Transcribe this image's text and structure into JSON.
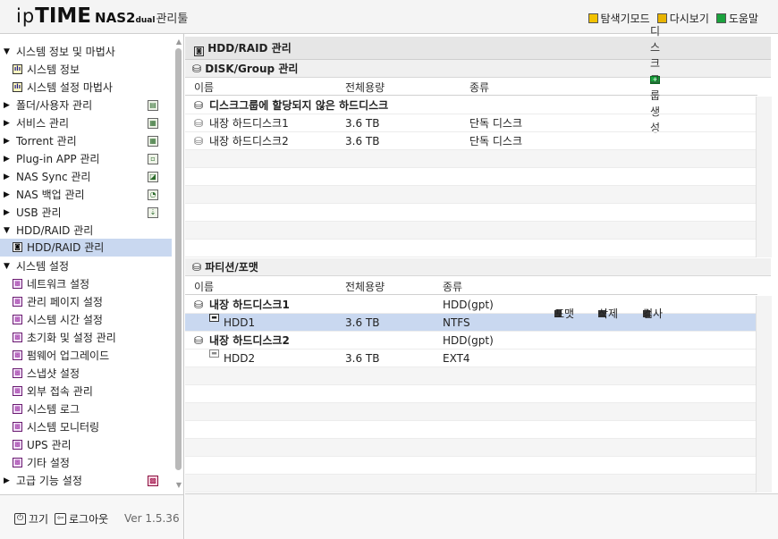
{
  "header": {
    "logo_ip": "ip",
    "logo_time": "TIME",
    "logo_model": "NAS2",
    "logo_sub": "dual",
    "logo_tool": "관리툴",
    "links": [
      {
        "label": "탐색기모드",
        "icon": "explorer-icon"
      },
      {
        "label": "다시보기",
        "icon": "refresh-icon"
      },
      {
        "label": "도움말",
        "icon": "help-icon"
      }
    ]
  },
  "sidebar": {
    "items": [
      {
        "label": "시스템 정보 및 마법사",
        "level": 0,
        "expanded": true
      },
      {
        "label": "시스템 정보",
        "level": 1
      },
      {
        "label": "시스템 설정 마법사",
        "level": 1
      },
      {
        "label": "폴더/사용자 관리",
        "level": 0,
        "expanded": false
      },
      {
        "label": "서비스 관리",
        "level": 0,
        "expanded": false
      },
      {
        "label": "Torrent 관리",
        "level": 0,
        "expanded": false
      },
      {
        "label": "Plug-in APP 관리",
        "level": 0,
        "expanded": false
      },
      {
        "label": "NAS Sync 관리",
        "level": 0,
        "expanded": false
      },
      {
        "label": "NAS 백업 관리",
        "level": 0,
        "expanded": false
      },
      {
        "label": "USB 관리",
        "level": 0,
        "expanded": false
      },
      {
        "label": "HDD/RAID 관리",
        "level": 0,
        "expanded": true
      },
      {
        "label": "HDD/RAID 관리",
        "level": 1,
        "selected": true
      },
      {
        "label": "시스템 설정",
        "level": 0,
        "expanded": true
      },
      {
        "label": "네트워크 설정",
        "level": 1
      },
      {
        "label": "관리 페이지 설정",
        "level": 1
      },
      {
        "label": "시스템 시간 설정",
        "level": 1
      },
      {
        "label": "초기화 및 설정 관리",
        "level": 1
      },
      {
        "label": "펌웨어 업그레이드",
        "level": 1
      },
      {
        "label": "스냅샷 설정",
        "level": 1
      },
      {
        "label": "외부 접속 관리",
        "level": 1
      },
      {
        "label": "시스템 로그",
        "level": 1
      },
      {
        "label": "시스템 모니터링",
        "level": 1
      },
      {
        "label": "UPS 관리",
        "level": 1
      },
      {
        "label": "기타 설정",
        "level": 1
      },
      {
        "label": "고급 기능 설정",
        "level": 0,
        "expanded": false
      }
    ],
    "footer": {
      "power_label": "끄기",
      "logout_label": "로그아웃",
      "version": "Ver 1.5.36"
    }
  },
  "main": {
    "title": "HDD/RAID 관리",
    "disk_section": {
      "title": "DISK/Group 관리",
      "columns": [
        "이름",
        "전체용량",
        "종류"
      ],
      "create_label": "디스크그룹 생성",
      "group_title": "디스크그룹에 할당되지 않은 하드디스크",
      "rows": [
        {
          "name": "내장 하드디스크1",
          "capacity": "3.6 TB",
          "type": "단독 디스크"
        },
        {
          "name": "내장 하드디스크2",
          "capacity": "3.6 TB",
          "type": "단독 디스크"
        }
      ]
    },
    "partition_section": {
      "title": "파티션/포맷",
      "columns": [
        "이름",
        "전체용량",
        "종류"
      ],
      "disks": [
        {
          "name": "내장 하드디스크1",
          "type": "HDD(gpt)",
          "partitions": [
            {
              "name": "HDD1",
              "capacity": "3.6 TB",
              "fs": "NTFS",
              "selected": true
            }
          ]
        },
        {
          "name": "내장 하드디스크2",
          "type": "HDD(gpt)",
          "partitions": [
            {
              "name": "HDD2",
              "capacity": "3.6 TB",
              "fs": "EXT4",
              "selected": false
            }
          ]
        }
      ],
      "actions": [
        "포맷",
        "삭제",
        "검사"
      ]
    }
  }
}
